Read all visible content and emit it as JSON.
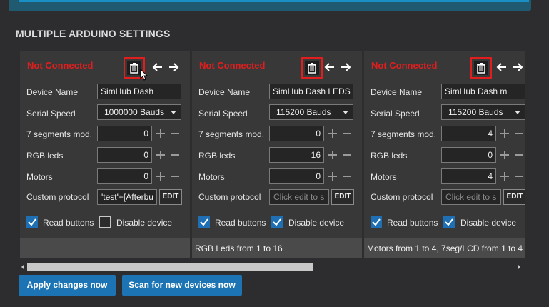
{
  "section": {
    "title": "MULTIPLE ARDUINO SETTINGS"
  },
  "labels": {
    "device_name": "Device Name",
    "serial_speed": "Serial Speed",
    "seven_segments": "7 segments mod.",
    "rgb_leds": "RGB leds",
    "motors": "Motors",
    "custom_protocol": "Custom protocol",
    "read_buttons": "Read buttons",
    "disable_device": "Disable device",
    "edit": "EDIT"
  },
  "cards": [
    {
      "status": "Not Connected",
      "device_name": "SimHub Dash",
      "serial_speed": "1000000 Bauds",
      "seven_segments": "0",
      "rgb_leds": "0",
      "motors": "0",
      "custom_protocol": "'test'+[Afterbu",
      "custom_protocol_placeholder": "",
      "read_buttons": true,
      "disable_device": false,
      "footer": ""
    },
    {
      "status": "Not Connected",
      "device_name": "SimHub Dash LEDS",
      "serial_speed": "115200 Bauds",
      "seven_segments": "0",
      "rgb_leds": "16",
      "motors": "0",
      "custom_protocol": "",
      "custom_protocol_placeholder": "Click edit to s",
      "read_buttons": true,
      "disable_device": true,
      "footer": "RGB Leds from 1 to 16"
    },
    {
      "status": "Not Connected",
      "device_name": "SimHub Dash m",
      "serial_speed": "115200 Bauds",
      "seven_segments": "4",
      "rgb_leds": "0",
      "motors": "4",
      "custom_protocol": "",
      "custom_protocol_placeholder": "Click edit to s",
      "read_buttons": true,
      "disable_device": true,
      "footer": "Motors from 1 to 4, 7seg/LCD from 1 to 4"
    }
  ],
  "scrollbar": {
    "position_fraction": 0.0
  },
  "buttons": {
    "apply": "Apply changes now",
    "scan": "Scan for new devices now"
  },
  "colors": {
    "accent": "#1c74b4",
    "status_red": "#e01e1e",
    "checkbox_on": "#1e6fb3"
  }
}
